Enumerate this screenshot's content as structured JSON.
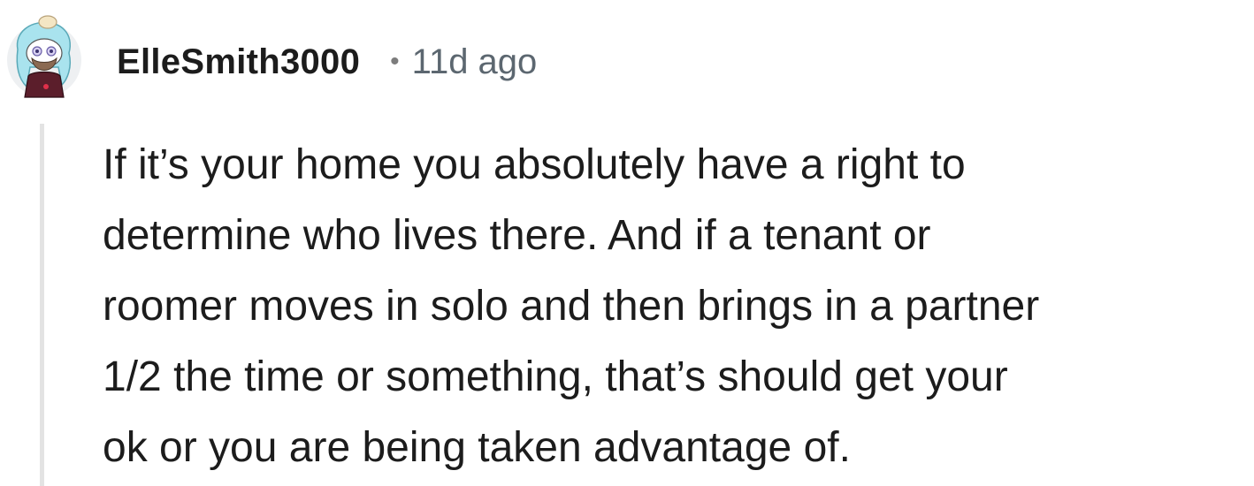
{
  "comment": {
    "author": "ElleSmith3000",
    "separator": "•",
    "timestamp": "11d ago",
    "avatar_icon": "snoo-avatar-icon",
    "body_lines": [
      "If it’s your home you absolutely have a right to",
      "determine who lives there. And if a tenant or",
      "roomer moves in solo and then brings in a partner",
      "1/2 the time or something, that’s should get your",
      "ok or you are being taken advantage of."
    ]
  },
  "colors": {
    "text": "#1c1c1c",
    "meta": "#5c6770",
    "thread_line": "#e3e3e3",
    "background": "#ffffff"
  }
}
